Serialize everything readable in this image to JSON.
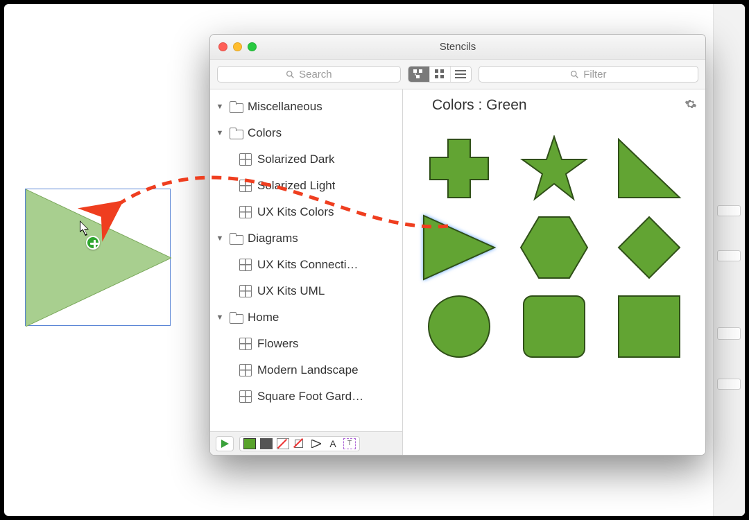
{
  "window": {
    "title": "Stencils",
    "search_placeholder": "Search",
    "filter_placeholder": "Filter"
  },
  "tree": {
    "groups": [
      {
        "name": "Miscellaneous",
        "expanded": true,
        "children": []
      },
      {
        "name": "Colors",
        "expanded": true,
        "children": [
          {
            "name": "Solarized Dark"
          },
          {
            "name": "Solarized Light"
          },
          {
            "name": "UX Kits Colors"
          }
        ]
      },
      {
        "name": "Diagrams",
        "expanded": true,
        "children": [
          {
            "name": "UX Kits Connecti…"
          },
          {
            "name": "UX Kits UML"
          }
        ]
      },
      {
        "name": "Home",
        "expanded": true,
        "children": [
          {
            "name": "Flowers"
          },
          {
            "name": "Modern Landscape"
          },
          {
            "name": "Square Foot Gard…"
          }
        ]
      }
    ]
  },
  "gallery": {
    "title": "Colors : Green",
    "shapes": [
      "plus",
      "star",
      "right-triangle",
      "play-triangle",
      "hexagon",
      "diamond",
      "circle",
      "rounded-square",
      "square"
    ],
    "fill": "#62a433",
    "stroke": "#2f4f18"
  },
  "bottombar": {
    "tools": [
      "play",
      "fill-square",
      "line",
      "no-fill",
      "no-stroke",
      "triangle-outline",
      "text-A",
      "text-T"
    ]
  },
  "canvas": {
    "drop_shape": "play-triangle",
    "drop_fill": "#a8cf8f",
    "drop_stroke": "#7aa85b"
  }
}
